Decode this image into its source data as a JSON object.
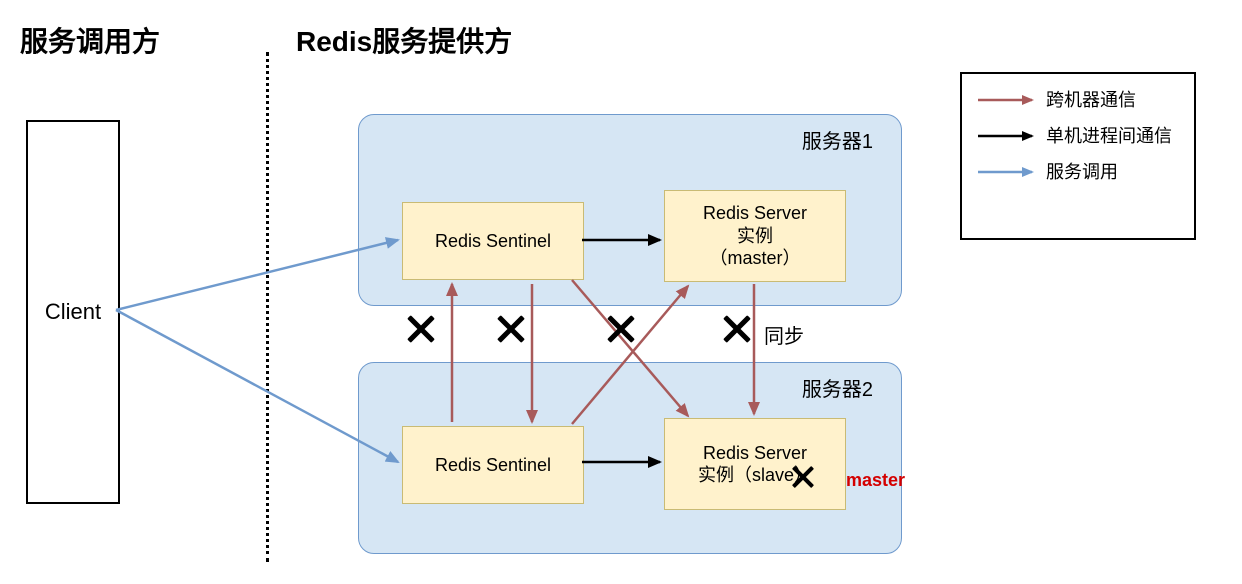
{
  "headings": {
    "left": "服务调用方",
    "right": "Redis服务提供方"
  },
  "client": {
    "label": "Client"
  },
  "server1": {
    "label": "服务器1",
    "sentinel": "Redis Sentinel",
    "redis_line1": "Redis Server",
    "redis_line2": "实例",
    "redis_line3": "（master）"
  },
  "server2": {
    "label": "服务器2",
    "sentinel": "Redis Sentinel",
    "redis_line1": "Redis Server",
    "redis_line2": "实例（slave）",
    "master_new": "master"
  },
  "sync_label": "同步",
  "legend": {
    "cross_machine": "跨机器通信",
    "local_ipc": "单机进程间通信",
    "service_call": "服务调用"
  },
  "colors": {
    "cross_arrow": "#a85a5a",
    "black_arrow": "#000000",
    "blue_arrow": "#6f9acd",
    "panel_fill": "#d6e6f4",
    "panel_border": "#6f9acd",
    "node_fill": "#fff2cc",
    "node_border": "#c9bb74",
    "master_text": "#d40000"
  }
}
